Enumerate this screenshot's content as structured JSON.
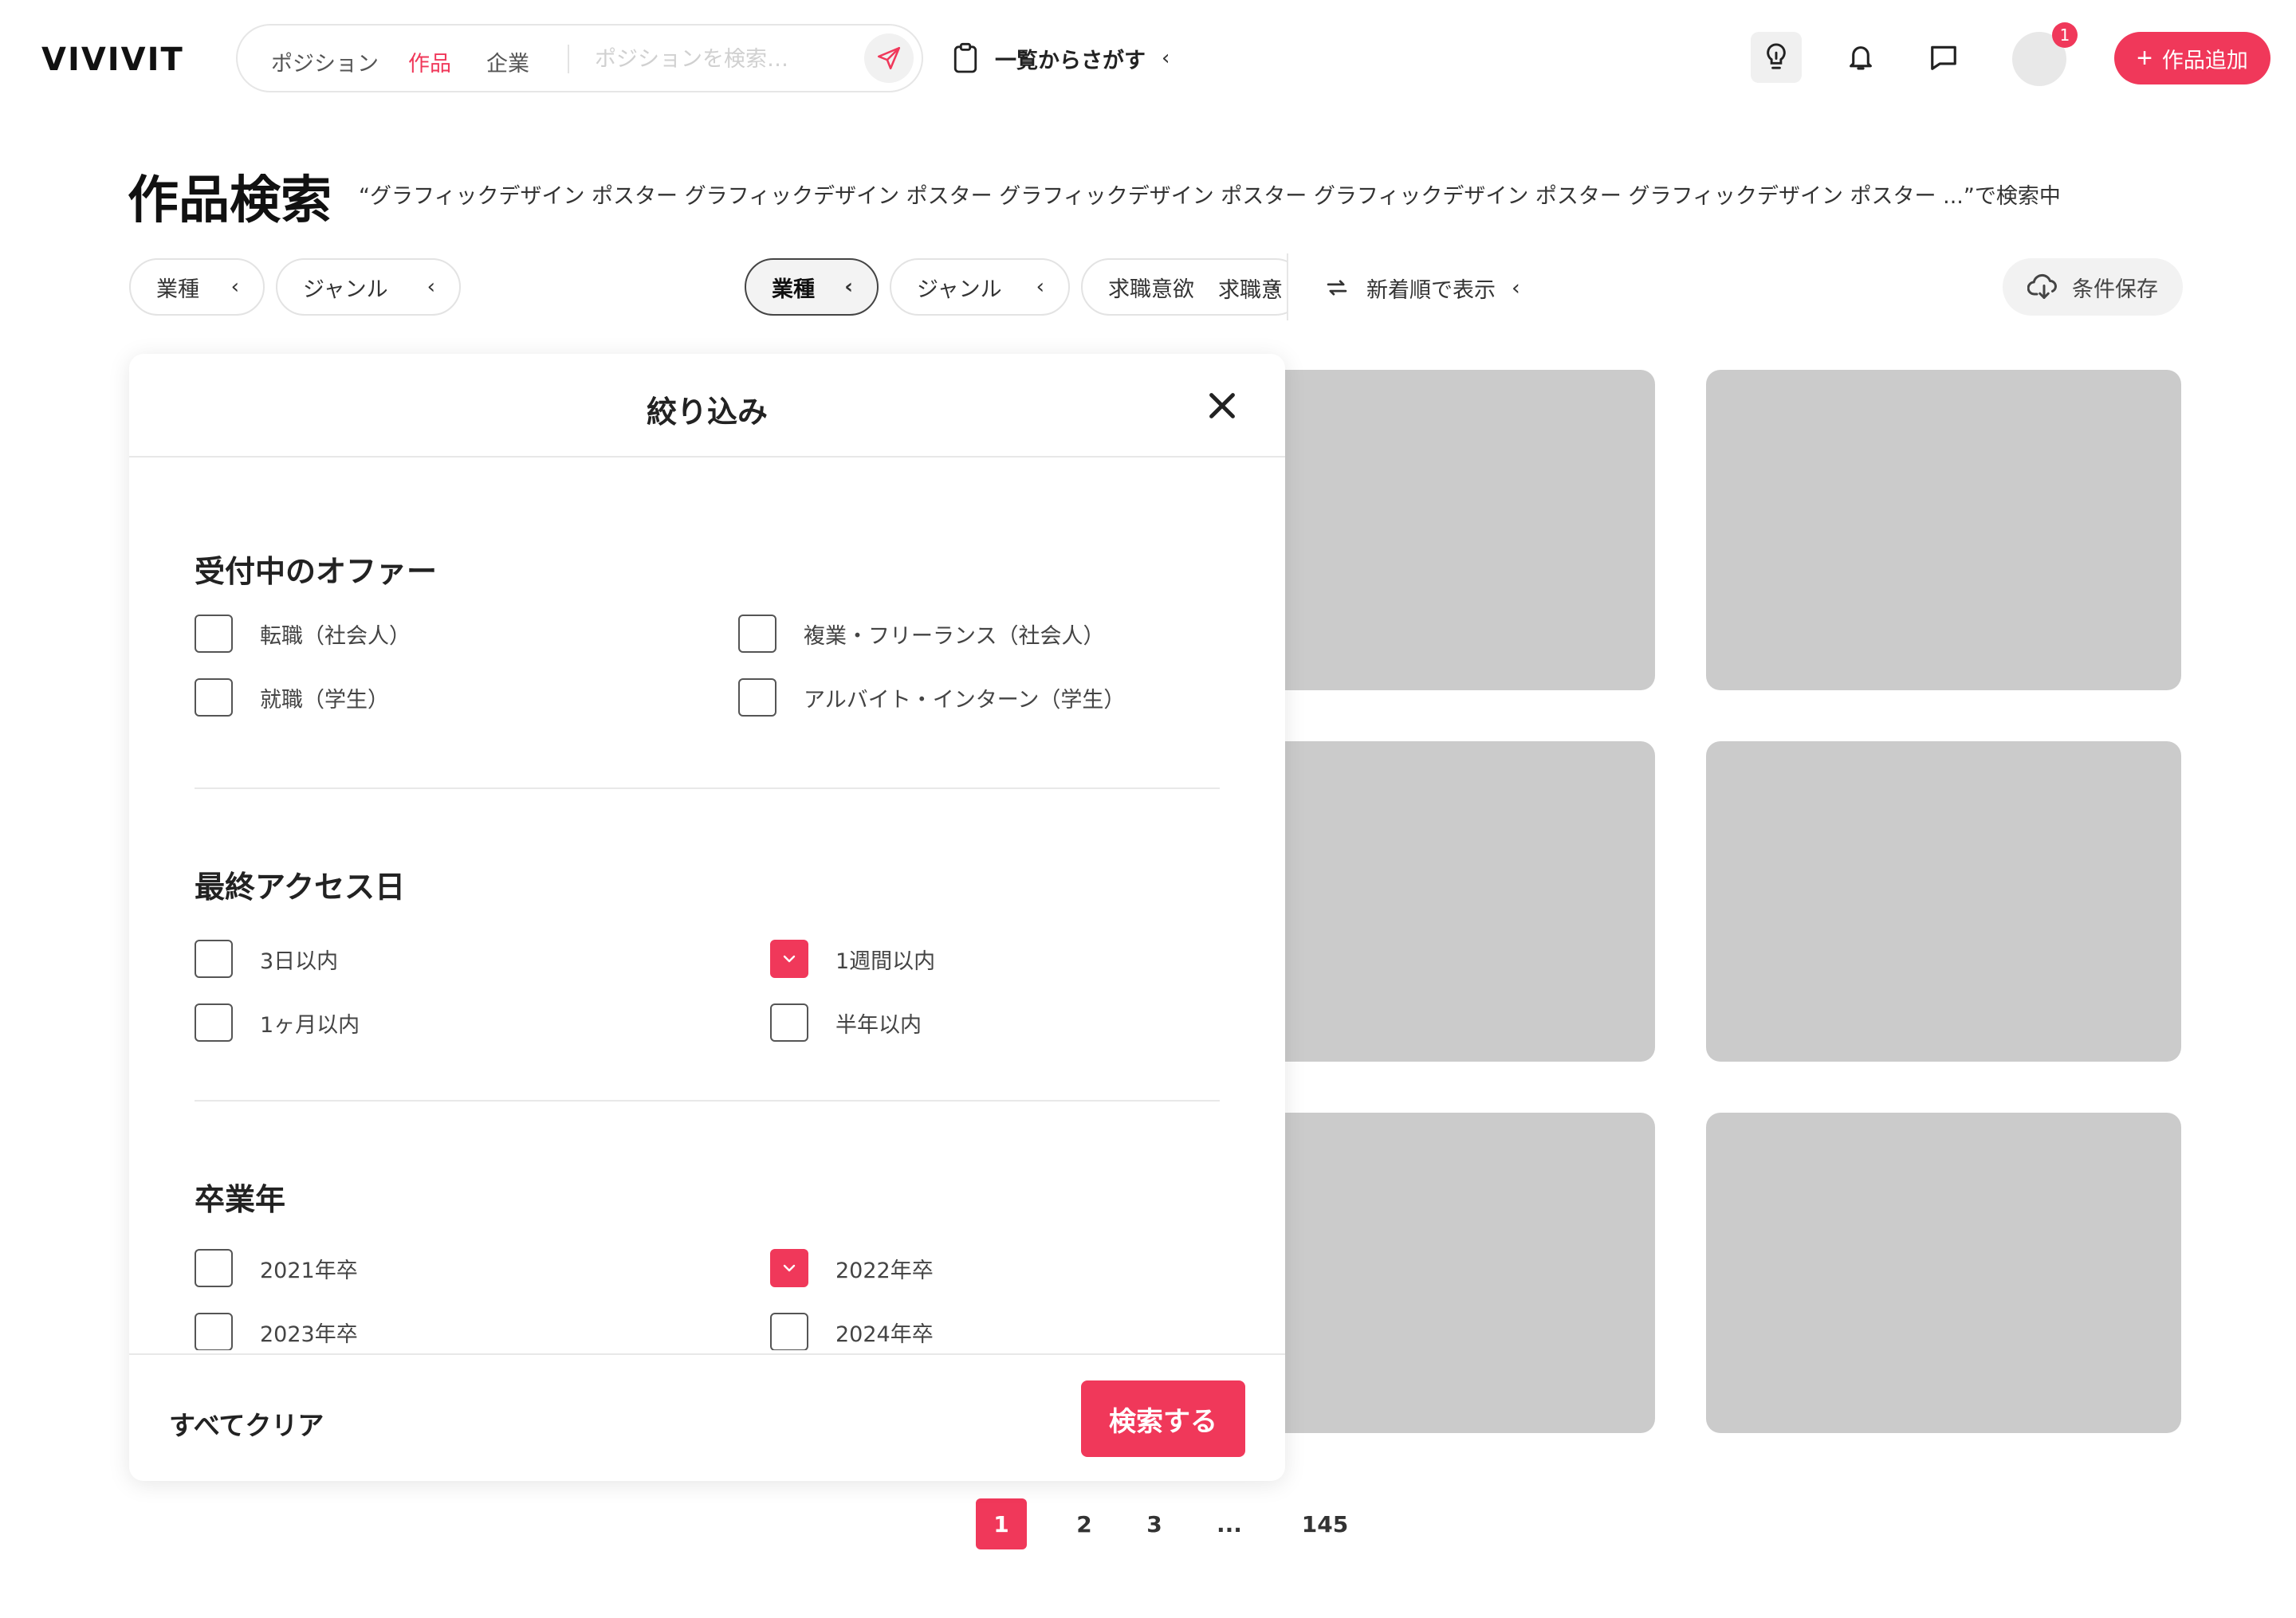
{
  "header": {
    "logo": "VIVIVIT",
    "tabs": [
      "ポジション",
      "作品",
      "企業"
    ],
    "active_tab": "作品",
    "search_placeholder": "ポジションを検索…",
    "list_link": "一覧からさがす",
    "notification_count": "1",
    "add_button": "作品追加"
  },
  "page": {
    "title": "作品検索",
    "query_status": "“グラフィックデザイン ポスター グラフィックデザイン ポスター グラフィックデザイン ポスター グラフィックデザイン ポスター グラフィックデザイン ポスター ...”で検索中"
  },
  "filters": {
    "left_chips": [
      "業種",
      "ジャンル"
    ],
    "right_chips": [
      "業種",
      "ジャンル",
      "求職意欲"
    ],
    "overflow_chip": "求職意",
    "sort_label": "新着順で表示",
    "save_label": "条件保存"
  },
  "modal": {
    "title": "絞り込み",
    "sections": [
      {
        "title": "受付中のオファー",
        "options": [
          {
            "label": "転職（社会人）",
            "checked": false
          },
          {
            "label": "複業・フリーランス（社会人）",
            "checked": false
          },
          {
            "label": "就職（学生）",
            "checked": false
          },
          {
            "label": "アルバイト・インターン（学生）",
            "checked": false
          }
        ]
      },
      {
        "title": "最終アクセス日",
        "options": [
          {
            "label": "3日以内",
            "checked": false
          },
          {
            "label": "1週間以内",
            "checked": true
          },
          {
            "label": "1ヶ月以内",
            "checked": false
          },
          {
            "label": "半年以内",
            "checked": false
          }
        ]
      },
      {
        "title": "卒業年",
        "options": [
          {
            "label": "2021年卒",
            "checked": false
          },
          {
            "label": "2022年卒",
            "checked": true
          },
          {
            "label": "2023年卒",
            "checked": false
          },
          {
            "label": "2024年卒",
            "checked": false
          }
        ]
      }
    ],
    "clear_label": "すべてクリア",
    "search_label": "検索する"
  },
  "pagination": {
    "pages": [
      "1",
      "2",
      "3",
      "...",
      "145"
    ],
    "current": "1"
  },
  "colors": {
    "accent": "#f0385a",
    "placeholder_card": "#cbcbcb"
  }
}
